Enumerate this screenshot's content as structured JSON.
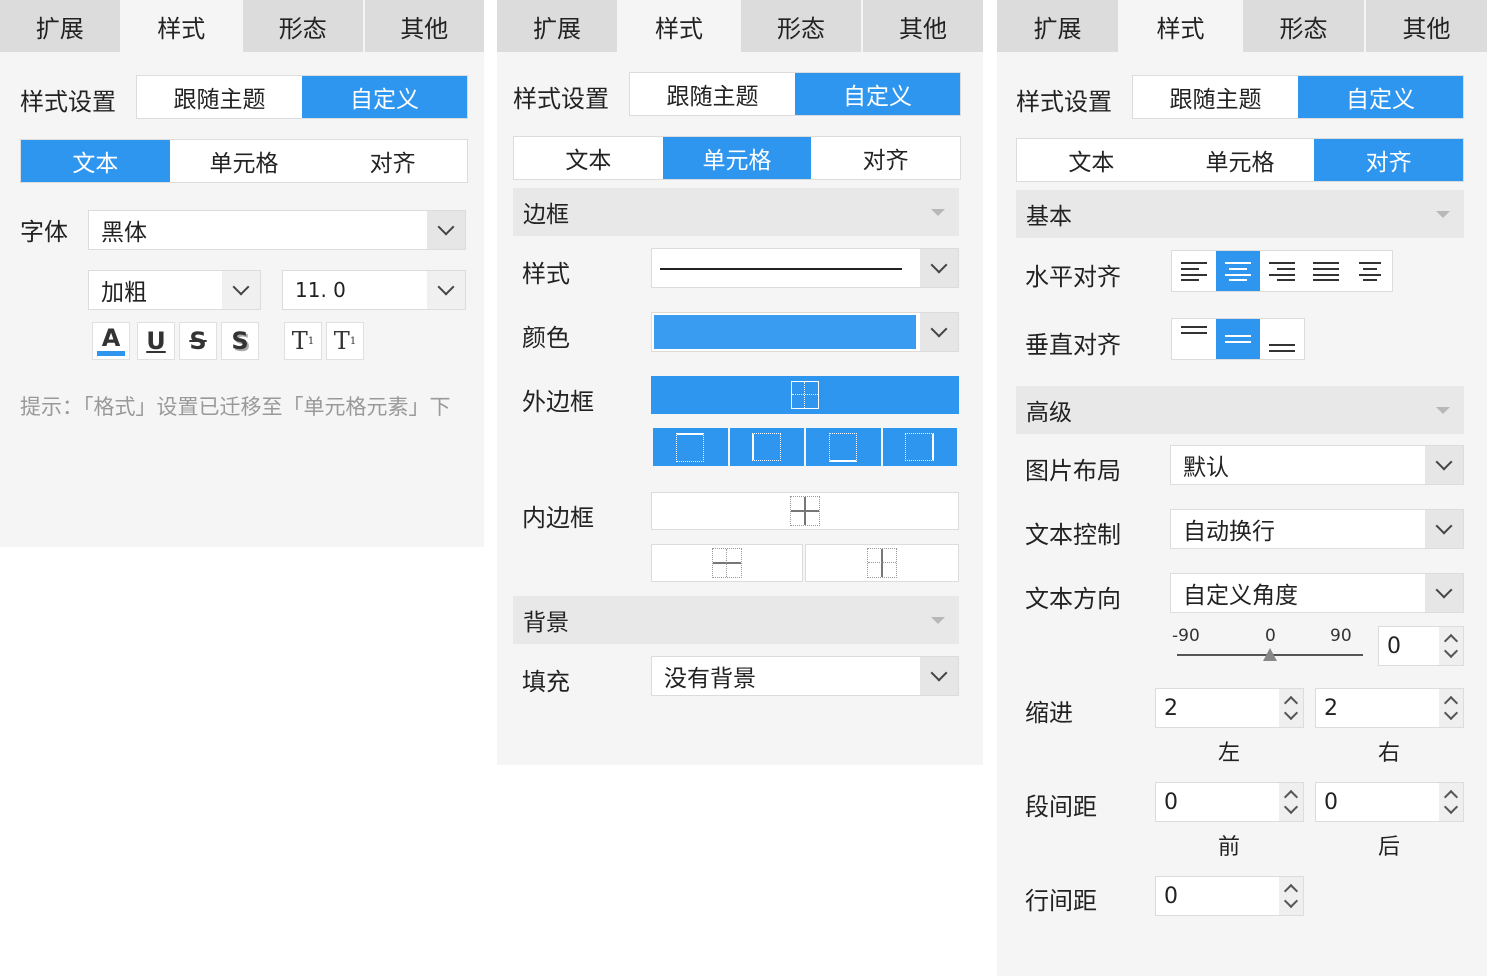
{
  "tabs": [
    "扩展",
    "样式",
    "形态",
    "其他"
  ],
  "style_setting": {
    "label": "样式设置",
    "options": [
      "跟随主题",
      "自定义"
    ],
    "selected": "自定义"
  },
  "sub_tabs": [
    "文本",
    "单元格",
    "对齐"
  ],
  "panel1": {
    "font_label": "字体",
    "font_family": "黑体",
    "font_weight": "加粗",
    "font_size": "11. 0",
    "format_buttons": [
      "A",
      "U",
      "S",
      "S",
      "T",
      "T"
    ],
    "hint": "提示：「格式」设置已迁移至「单元格元素」下"
  },
  "panel2": {
    "border_section": "边框",
    "style_label": "样式",
    "color_label": "颜色",
    "color_value": "#3a9cf0",
    "outer_border_label": "外边框",
    "inner_border_label": "内边框",
    "background_section": "背景",
    "fill_label": "填充",
    "fill_value": "没有背景"
  },
  "panel3": {
    "basic_section": "基本",
    "h_align_label": "水平对齐",
    "v_align_label": "垂直对齐",
    "advanced_section": "高级",
    "image_layout_label": "图片布局",
    "image_layout_value": "默认",
    "text_control_label": "文本控制",
    "text_control_value": "自动换行",
    "text_direction_label": "文本方向",
    "text_direction_value": "自定义角度",
    "angle_min": "-90",
    "angle_mid": "0",
    "angle_max": "90",
    "angle_value": "0",
    "indent_label": "缩进",
    "indent_left": "2",
    "indent_right": "2",
    "left_caption": "左",
    "right_caption": "右",
    "para_spacing_label": "段间距",
    "para_before": "0",
    "para_after": "0",
    "before_caption": "前",
    "after_caption": "后",
    "line_spacing_label": "行间距",
    "line_spacing_value": "0"
  }
}
